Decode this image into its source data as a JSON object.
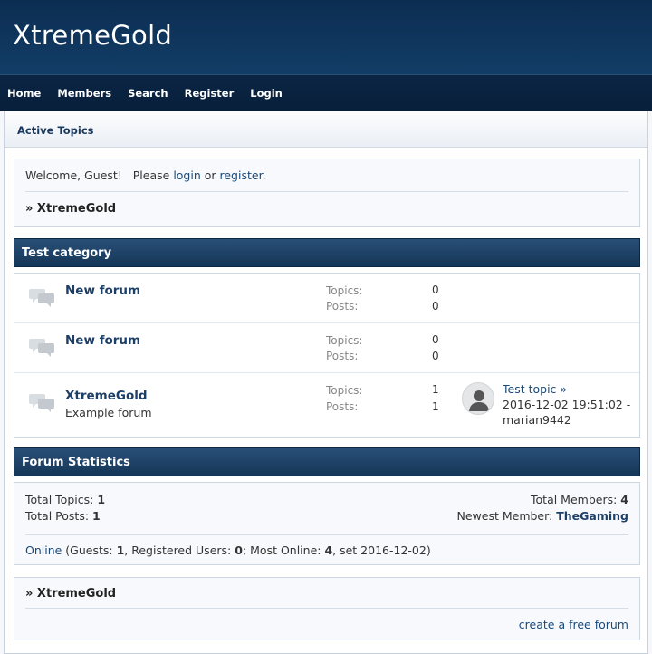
{
  "header": {
    "title": "XtremeGold"
  },
  "nav": [
    "Home",
    "Members",
    "Search",
    "Register",
    "Login"
  ],
  "subbar": {
    "link": "Active Topics"
  },
  "welcome": {
    "prefix": "Welcome, Guest!   Please ",
    "login": "login",
    "or": " or ",
    "register": "register",
    "suffix": ".",
    "crumb": "» XtremeGold"
  },
  "category": {
    "title": "Test category",
    "topics_label": "Topics:",
    "posts_label": "Posts:",
    "forums": [
      {
        "name": "New forum",
        "desc": "",
        "topics": "0",
        "posts": "0"
      },
      {
        "name": "New forum",
        "desc": "",
        "topics": "0",
        "posts": "0"
      },
      {
        "name": "XtremeGold",
        "desc": "Example forum",
        "topics": "1",
        "posts": "1",
        "last_post": {
          "topic": "Test topic »",
          "date": "2016-12-02 19:51:02 -",
          "author": "marian9442"
        }
      }
    ]
  },
  "stats": {
    "title": "Forum Statistics",
    "total_topics_label": "Total Topics: ",
    "total_topics": "1",
    "total_posts_label": "Total Posts: ",
    "total_posts": "1",
    "total_members_label": "Total Members: ",
    "total_members": "4",
    "newest_label": "Newest Member: ",
    "newest": "TheGaming",
    "online_link": "Online",
    "online_guests_label": " (Guests: ",
    "guests": "1",
    "online_reg_label": ", Registered Users: ",
    "registered": "0",
    "online_most_label": "; Most Online: ",
    "most": "4",
    "online_date": ", set 2016-12-02)"
  },
  "footer": {
    "crumb": "» XtremeGold",
    "link": "create a free forum"
  },
  "colors": {
    "header": "#0c2d52",
    "navbar": "#0a2544",
    "link": "#1a4a7a",
    "category_bar": "#1f4468"
  }
}
